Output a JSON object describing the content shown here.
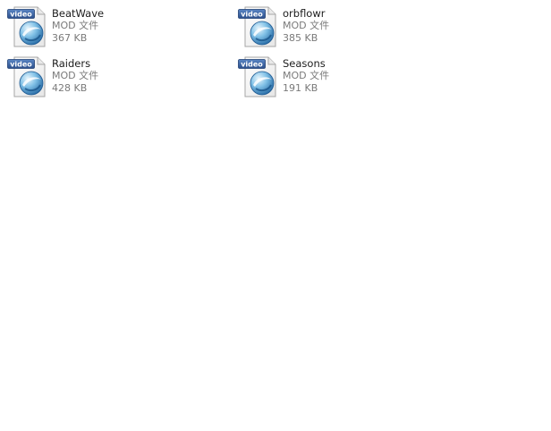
{
  "files": [
    {
      "name": "BeatWave",
      "type": "MOD 文件",
      "size": "367 KB",
      "icon": "video-file-icon",
      "badge": "video"
    },
    {
      "name": "orbflowr",
      "type": "MOD 文件",
      "size": "385 KB",
      "icon": "video-file-icon",
      "badge": "video"
    },
    {
      "name": "Raiders",
      "type": "MOD 文件",
      "size": "428 KB",
      "icon": "video-file-icon",
      "badge": "video"
    },
    {
      "name": "Seasons",
      "type": "MOD 文件",
      "size": "191 KB",
      "icon": "video-file-icon",
      "badge": "video"
    }
  ],
  "colors": {
    "badge_bg": "#3a66a8",
    "orb_dark": "#1f6aa8",
    "orb_light": "#bfe3f6",
    "page_fold": "#d9d9d9"
  }
}
